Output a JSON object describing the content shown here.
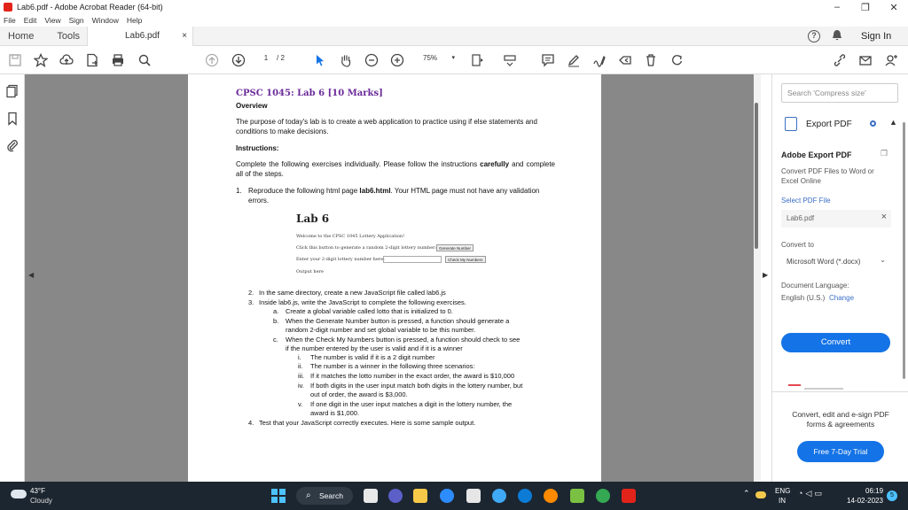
{
  "window": {
    "title": "Lab6.pdf - Adobe Acrobat Reader (64-bit)",
    "controls": {
      "minimize": "–",
      "restore": "❐",
      "close": "✕"
    }
  },
  "menu": [
    "File",
    "Edit",
    "View",
    "Sign",
    "Window",
    "Help"
  ],
  "tabs": {
    "home": "Home",
    "tools": "Tools",
    "document": "Lab6.pdf",
    "close": "×"
  },
  "header": {
    "help": "?",
    "signin": "Sign In"
  },
  "toolbar": {
    "page_current": "1",
    "page_total": "/ 2",
    "zoom": "75%"
  },
  "pdf": {
    "title": "CPSC 1045: Lab 6 [10 Marks]",
    "overview_heading": "Overview",
    "purpose": "The purpose of today's lab is to create a web application to practice using if else statements and conditions to make decisions.",
    "instructions_heading": "Instructions:",
    "complete_text_1": "Complete the following exercises individually. Please follow the instructions ",
    "complete_bold": "carefully",
    "complete_text_2": " and complete all of the steps.",
    "ex1_num": "1.",
    "ex1_text_1": "Reproduce the following html page ",
    "ex1_bold": "lab6.html",
    "ex1_text_2": ". Your HTML page must not have any validation errors.",
    "sample": {
      "heading": "Lab 6",
      "welcome": "Welcome to the CPSC 1045 Lottery Application!",
      "click_text": "Click this button to generate a random 2-digit lottery number:",
      "generate_btn": "Generate Number",
      "enter_text": "Enter your 2-digit lottery number here:",
      "check_btn": "Check My Numbers",
      "output": "Output here"
    },
    "items": [
      {
        "n": "2.",
        "text": "In the same directory, create a new JavaScript file called lab6.js"
      },
      {
        "n": "3.",
        "text": "Inside lab6.js, write the JavaScript to complete the following exercises."
      }
    ],
    "sub_a": {
      "n": "a.",
      "text": "Create a global variable called lotto that is initialized to 0."
    },
    "sub_b": {
      "n": "b.",
      "line1": "When the Generate Number button is pressed, a function should generate a",
      "line2": "random 2-digit number and set global variable to be this number."
    },
    "sub_c": {
      "n": "c.",
      "line1": "When the Check My Numbers button is pressed, a function should check to see",
      "line2": "if the number entered by the user is valid and if it is a winner"
    },
    "roman": [
      {
        "n": "i.",
        "lines": [
          "The number is valid if it is a 2 digit number"
        ]
      },
      {
        "n": "ii.",
        "lines": [
          "The number is a winner in the following three scenarios:"
        ]
      },
      {
        "n": "iii.",
        "lines": [
          "If it matches the lotto number in the exact order, the award is $10,000"
        ]
      },
      {
        "n": "iv.",
        "lines": [
          "If both digits in the user input match both digits in the lottery number, but",
          "out of order, the award is $3,000."
        ]
      },
      {
        "n": "v.",
        "lines": [
          "If one digit in the user input matches a digit in the lottery number, the",
          "award is $1,000."
        ]
      }
    ],
    "item4": {
      "n": "4.",
      "text": "Test that your JavaScript correctly executes. Here is some sample output."
    }
  },
  "right_panel": {
    "search_placeholder": "Search 'Compress size'",
    "export_label": "Export PDF",
    "adobe_export": "Adobe Export PDF",
    "description": "Convert PDF Files to Word or Excel Online",
    "select_label": "Select PDF File",
    "file_name": "Lab6.pdf",
    "convert_to": "Convert to",
    "format": "Microsoft Word (*.docx)",
    "doc_language_label": "Document Language:",
    "language": "English (U.S.)",
    "change": "Change",
    "convert_button": "Convert",
    "promo": "Convert, edit and e-sign PDF forms & agreements",
    "trial_button": "Free 7-Day Trial"
  },
  "taskbar": {
    "temp": "43°F",
    "condition": "Cloudy",
    "search": "Search",
    "lang_1": "ENG",
    "lang_2": "IN",
    "time": "06:19",
    "date": "14-02-2023",
    "notifications": "5"
  },
  "colors": {
    "accent": "#1473e6",
    "pdf_title": "#6a2a9a",
    "taskbar": "#1c2630",
    "doc_background": "#888888"
  }
}
